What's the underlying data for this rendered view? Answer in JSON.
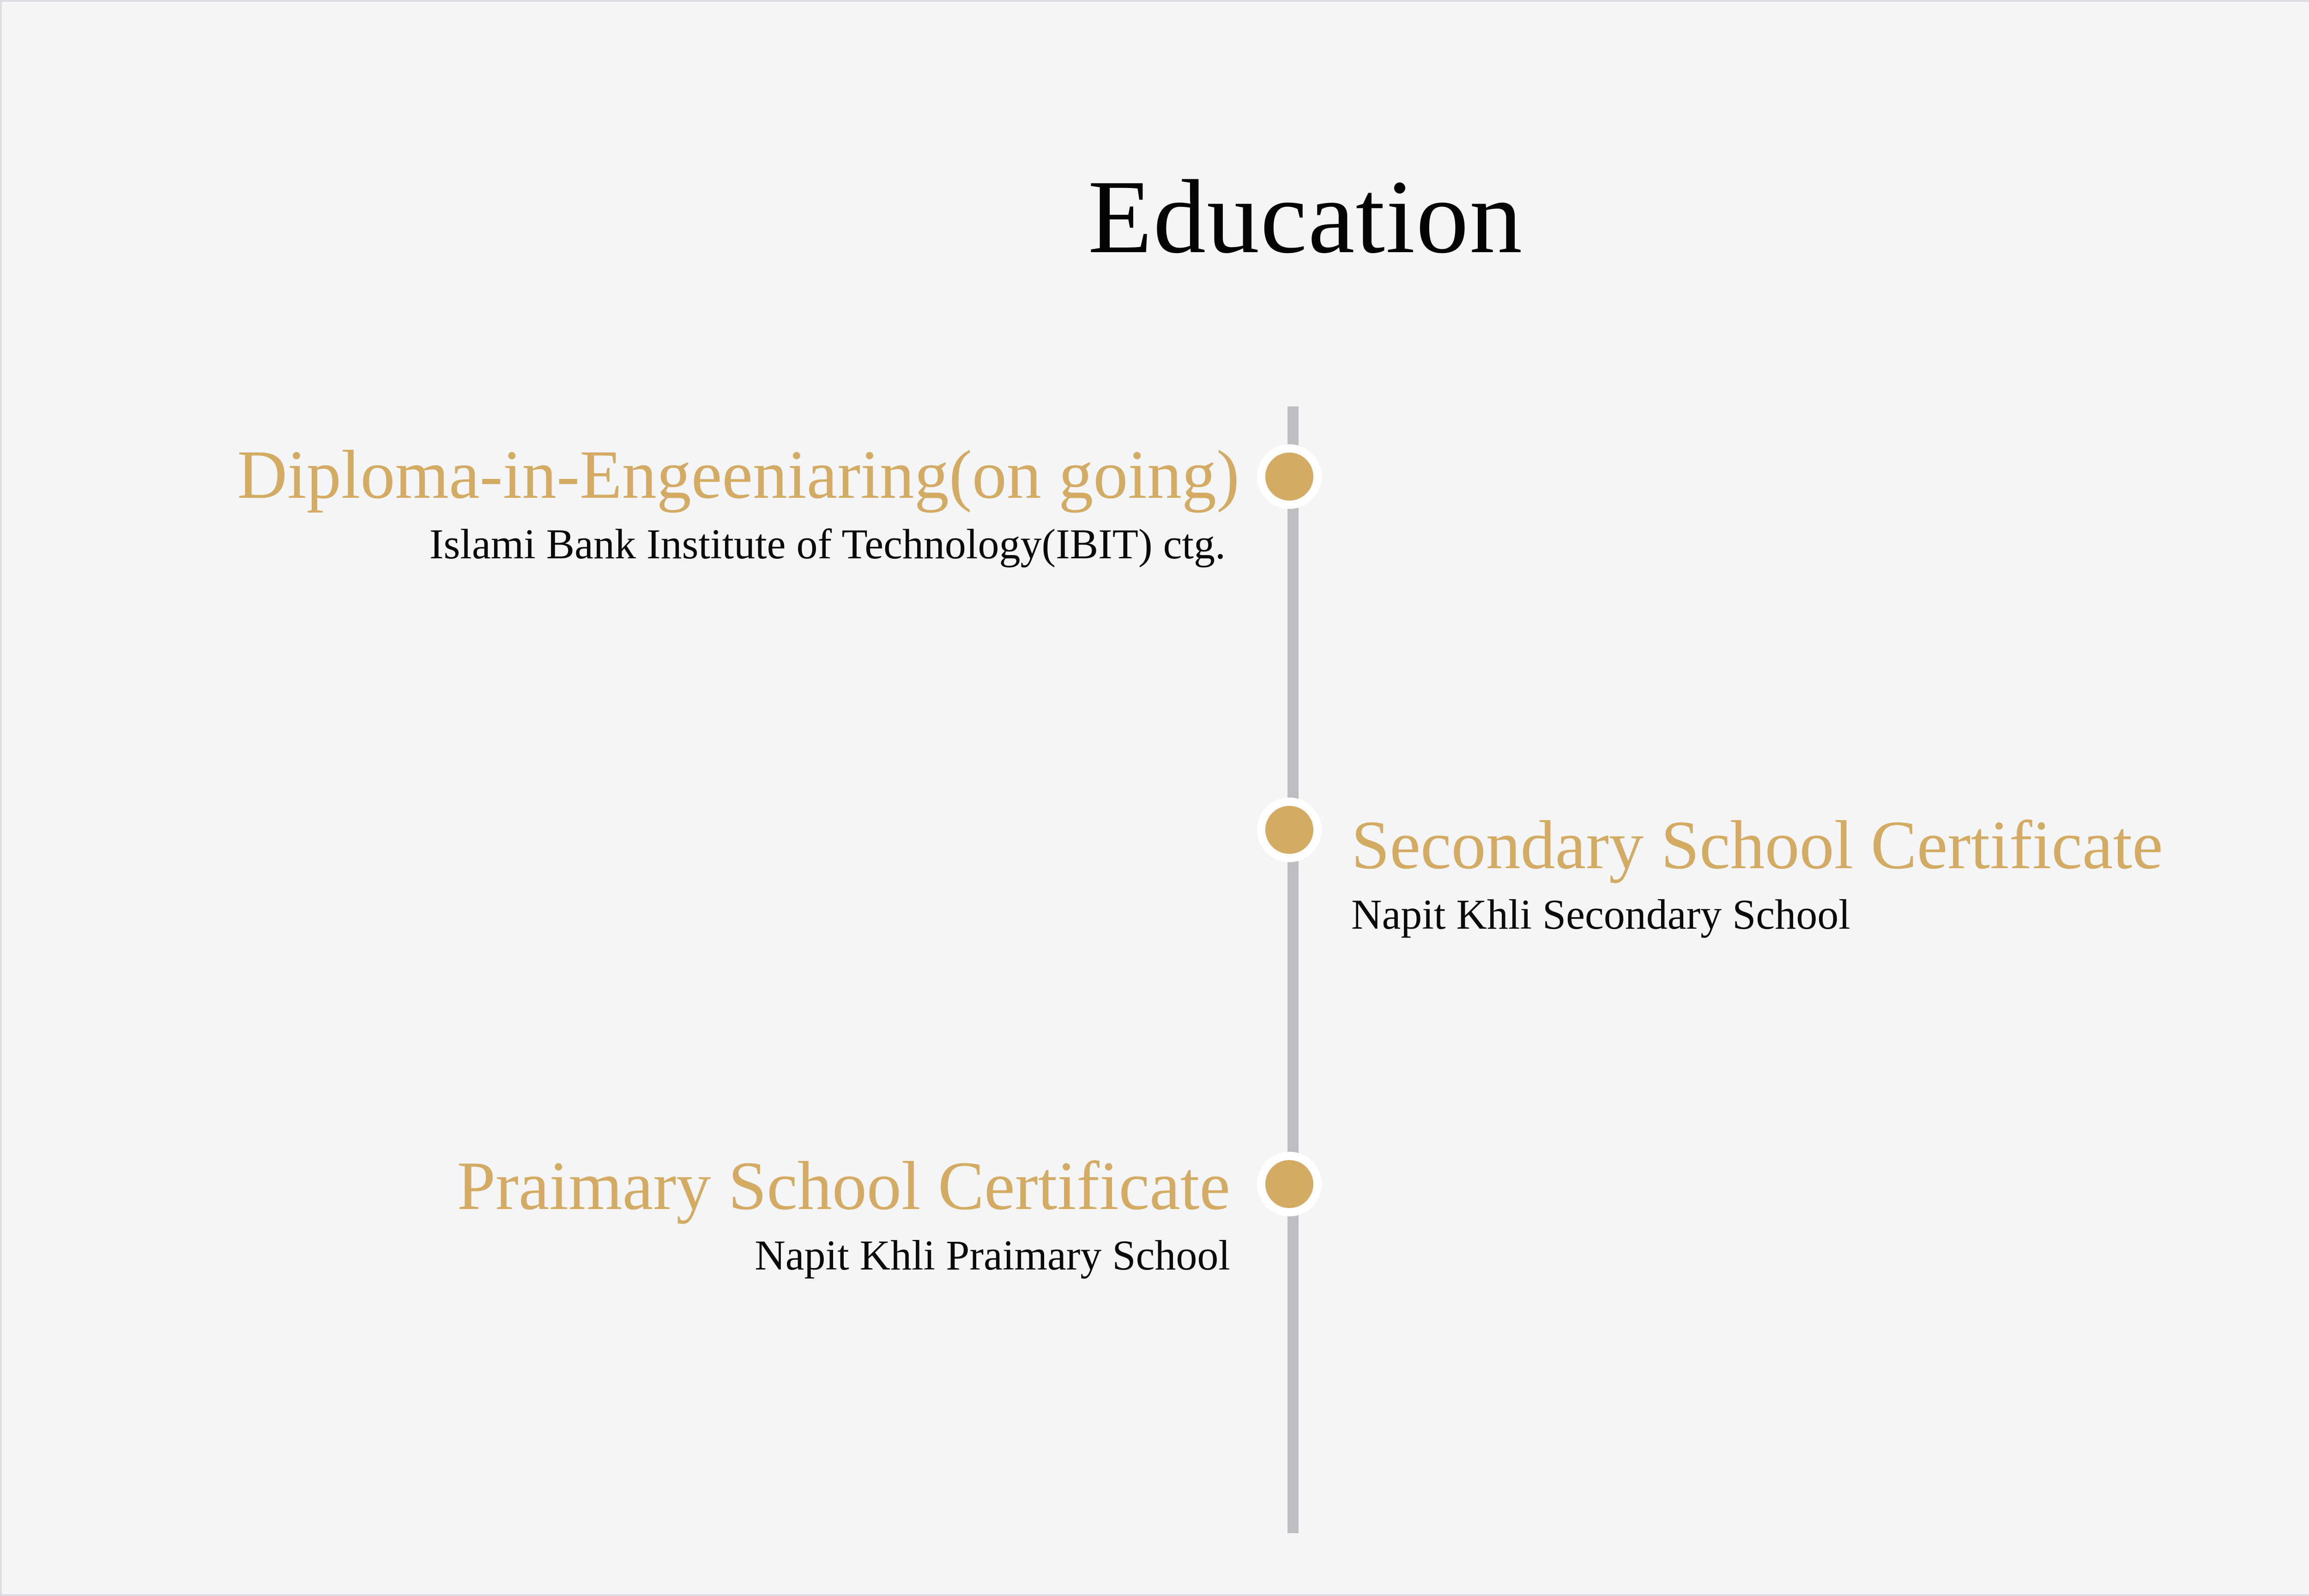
{
  "heading": "Education",
  "accent_color": "#d4ab62",
  "line_color": "#bdbec1",
  "entries": [
    {
      "title": "Diploma-in-Engeeniaring(on going)",
      "institution": "Islami Bank Institute of Technology(IBIT) ctg."
    },
    {
      "title": "Secondary School Certificate",
      "institution": "Napit Khli Secondary School"
    },
    {
      "title": "Praimary School Certificate",
      "institution": "Napit Khli Praimary School"
    }
  ]
}
